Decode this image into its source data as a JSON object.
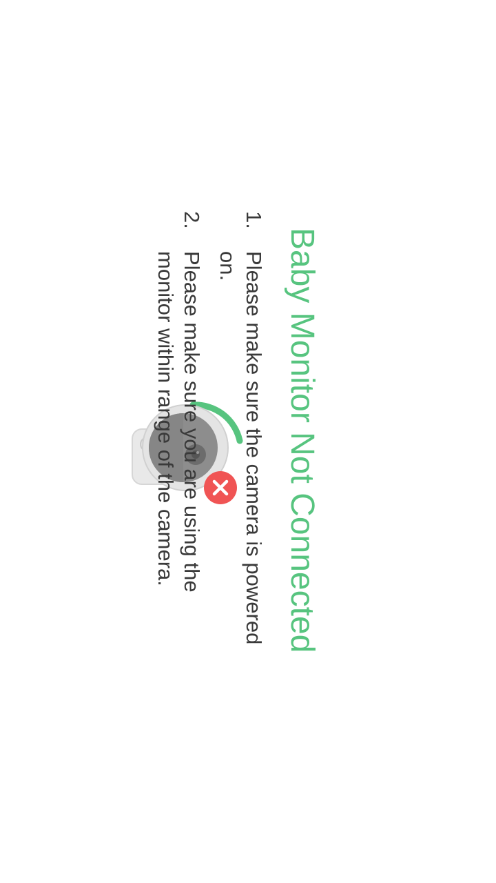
{
  "status": {
    "title": "Baby Monitor Not Connected",
    "title_color": "#57c47f",
    "error_color": "#f05454",
    "icon": "camera-disconnected-icon"
  },
  "instructions": [
    {
      "number": "1.",
      "text": "Please make sure the camera is powered on."
    },
    {
      "number": "2.",
      "text": "Please make sure you are using the monitor within range of the camera."
    }
  ]
}
